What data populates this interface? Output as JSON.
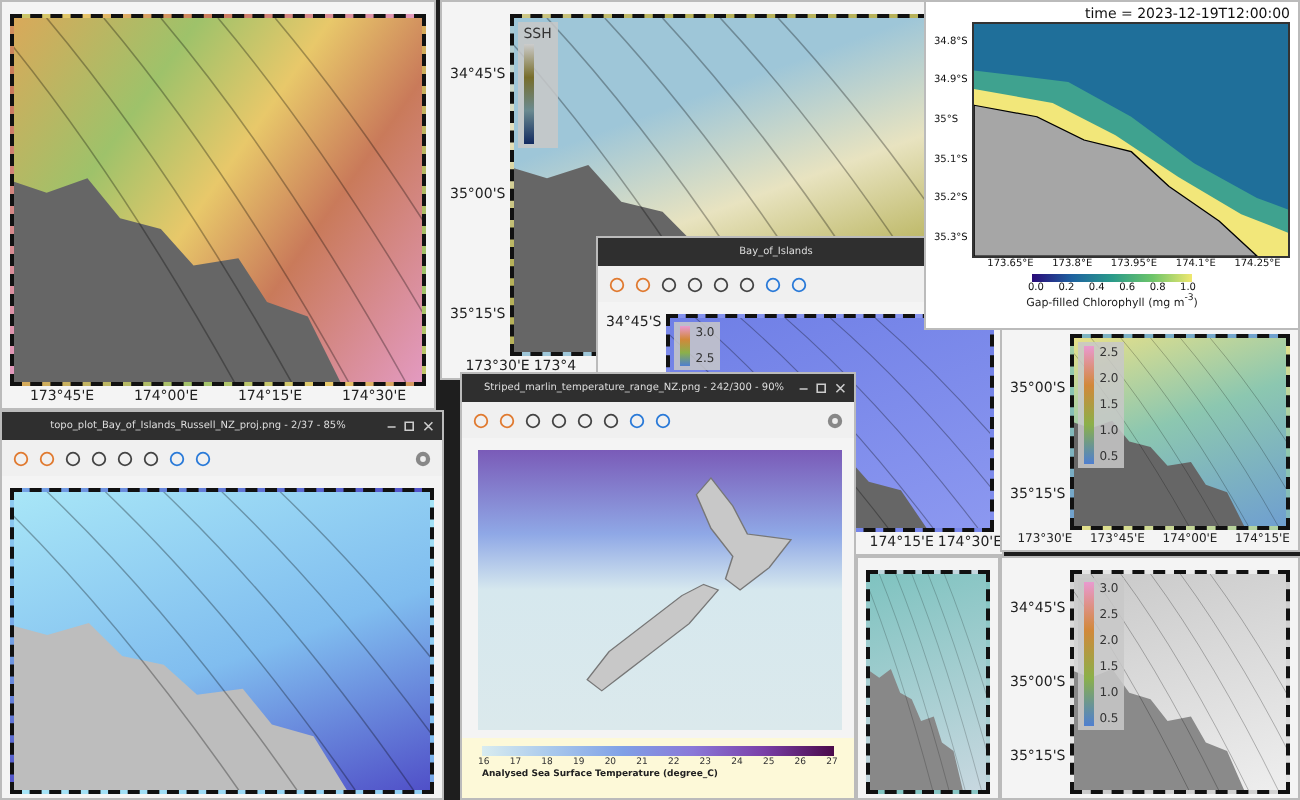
{
  "windows": [
    {
      "map": {
        "kind": "terrain",
        "xticks": [
          "173°45'E",
          "174°00'E",
          "174°15'E",
          "174°30'E"
        ]
      }
    },
    {
      "map": {
        "kind": "ssh",
        "yticks": [
          "34°45'S",
          "35°00'S",
          "35°15'S"
        ],
        "xticks": [
          "173°30'E",
          "173°4"
        ],
        "legend_title": "SSH"
      }
    },
    {
      "title": "Bay_of_Islands",
      "toolbar": true,
      "map": {
        "kind": "blue",
        "yticks": [
          "34°45'S"
        ],
        "xticks": [
          "174°15'E",
          "174°30'E"
        ],
        "legend": [
          "3.0",
          "2.5"
        ]
      }
    },
    {
      "map": {
        "kind": "chl",
        "yticks": [
          "35°00'S",
          "35°15'S"
        ],
        "xticks": [
          "173°30'E",
          "173°45'E",
          "174°00'E",
          "174°15'E"
        ],
        "legend": [
          "2.5",
          "2.0",
          "1.5",
          "1.0",
          "0.5"
        ]
      }
    },
    {
      "map": {
        "kind": "teal"
      }
    },
    {
      "map": {
        "kind": "grey",
        "yticks": [
          "34°45'S",
          "35°00'S",
          "35°15'S"
        ],
        "legend": [
          "3.0",
          "2.5",
          "2.0",
          "1.5",
          "1.0",
          "0.5"
        ]
      }
    },
    {
      "title": "topo_plot_Bay_of_Islands_Russell_NZ_proj.png - 2/37 - 85%",
      "toolbar": true,
      "map": {
        "kind": "topo"
      }
    }
  ],
  "chlorophyll_figure": {
    "title": "time = 2023-12-19T12:00:00",
    "yticks": [
      "34.8°S",
      "34.9°S",
      "35°S",
      "35.1°S",
      "35.2°S",
      "35.3°S"
    ],
    "xticks": [
      "173.65°E",
      "173.8°E",
      "173.95°E",
      "174.1°E",
      "174.25°E"
    ],
    "colorbar_ticks": [
      "0.0",
      "0.2",
      "0.4",
      "0.6",
      "0.8",
      "1.0"
    ],
    "colorbar_label": "Gap-filled Chlorophyll (mg m$^{-3}$)"
  },
  "sst_viewer": {
    "title": "Striped_marlin_temperature_range_NZ.png - 242/300 - 90%",
    "colorbar_ticks": [
      "16",
      "17",
      "18",
      "19",
      "20",
      "21",
      "22",
      "23",
      "24",
      "25",
      "26",
      "27"
    ],
    "colorbar_label": "Analysed Sea Surface Temperature (degree_C)"
  }
}
